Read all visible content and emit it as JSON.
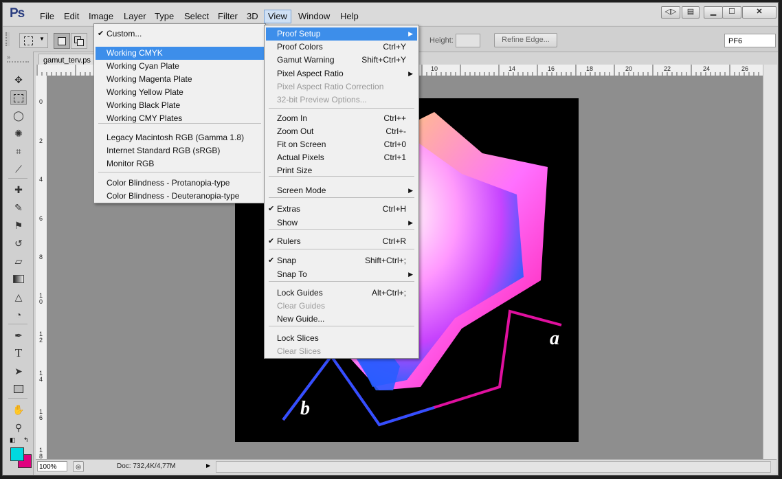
{
  "app": {
    "logo": "Ps"
  },
  "menubar": {
    "items": [
      "File",
      "Edit",
      "Image",
      "Layer",
      "Type",
      "Select",
      "Filter",
      "3D",
      "View",
      "Window",
      "Help"
    ]
  },
  "options": {
    "height_label": "Height:",
    "refine_label": "Refine Edge...",
    "workspace": "PF6"
  },
  "document": {
    "tab_title": "gamut_terv.ps",
    "zoom": "100%",
    "doc_info": "Doc: 732,4K/4,77M",
    "h_ruler": [
      "10",
      "12",
      "14",
      "16",
      "18",
      "20",
      "22",
      "24",
      "26"
    ],
    "v_ruler": [
      "0",
      "2",
      "4",
      "6",
      "8",
      "1\n0",
      "1\n2",
      "1\n4",
      "1\n6",
      "1\n8"
    ],
    "label_a": "a",
    "label_b": "b"
  },
  "view_menu": {
    "items": [
      {
        "label": "Proof Setup",
        "shortcut": "",
        "submenu": true,
        "state": "highlighted"
      },
      {
        "label": "Proof Colors",
        "shortcut": "Ctrl+Y"
      },
      {
        "label": "Gamut Warning",
        "shortcut": "Shift+Ctrl+Y"
      },
      {
        "label": "Pixel Aspect Ratio",
        "shortcut": "",
        "submenu": true
      },
      {
        "label": "Pixel Aspect Ratio Correction",
        "shortcut": "",
        "state": "disabled"
      },
      {
        "label": "32-bit Preview Options...",
        "shortcut": "",
        "state": "disabled"
      },
      {
        "label": "Zoom In",
        "shortcut": "Ctrl++"
      },
      {
        "label": "Zoom Out",
        "shortcut": "Ctrl+-"
      },
      {
        "label": "Fit on Screen",
        "shortcut": "Ctrl+0"
      },
      {
        "label": "Actual Pixels",
        "shortcut": "Ctrl+1"
      },
      {
        "label": "Print Size",
        "shortcut": ""
      },
      {
        "label": "Screen Mode",
        "shortcut": "",
        "submenu": true
      },
      {
        "label": "Extras",
        "shortcut": "Ctrl+H",
        "checked": true
      },
      {
        "label": "Show",
        "shortcut": "",
        "submenu": true
      },
      {
        "label": "Rulers",
        "shortcut": "Ctrl+R",
        "checked": true
      },
      {
        "label": "Snap",
        "shortcut": "Shift+Ctrl+;",
        "checked": true
      },
      {
        "label": "Snap To",
        "shortcut": "",
        "submenu": true
      },
      {
        "label": "Lock Guides",
        "shortcut": "Alt+Ctrl+;"
      },
      {
        "label": "Clear Guides",
        "shortcut": "",
        "state": "disabled"
      },
      {
        "label": "New Guide...",
        "shortcut": ""
      },
      {
        "label": "Lock Slices",
        "shortcut": ""
      },
      {
        "label": "Clear Slices",
        "shortcut": "",
        "state": "disabled"
      }
    ]
  },
  "proof_submenu": {
    "items": [
      {
        "label": "Custom...",
        "checked": true
      },
      {
        "label": "Working CMYK",
        "state": "highlighted"
      },
      {
        "label": "Working Cyan Plate"
      },
      {
        "label": "Working Magenta Plate"
      },
      {
        "label": "Working Yellow Plate"
      },
      {
        "label": "Working Black Plate"
      },
      {
        "label": "Working CMY Plates"
      },
      {
        "label": "Legacy Macintosh RGB (Gamma 1.8)"
      },
      {
        "label": "Internet Standard RGB (sRGB)"
      },
      {
        "label": "Monitor RGB"
      },
      {
        "label": "Color Blindness - Protanopia-type"
      },
      {
        "label": "Color Blindness - Deuteranopia-type"
      }
    ]
  },
  "colors": {
    "highlight": "#3d8eea",
    "foreground": "#00d9e0",
    "background": "#e0007f"
  },
  "icons": [
    "move-icon",
    "marquee-icon",
    "lasso-icon",
    "quick-select-icon",
    "crop-icon",
    "eyedropper-icon",
    "healing-icon",
    "brush-icon",
    "stamp-icon",
    "history-brush-icon",
    "eraser-icon",
    "gradient-icon",
    "blur-icon",
    "dodge-icon",
    "pen-icon",
    "type-icon",
    "path-select-icon",
    "shape-icon",
    "hand-icon",
    "zoom-icon"
  ]
}
